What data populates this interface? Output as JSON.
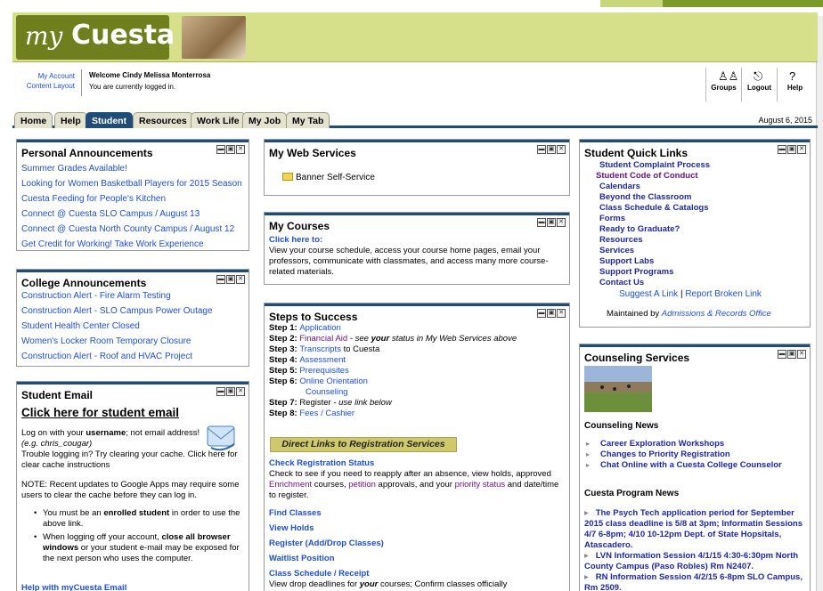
{
  "logo": {
    "my": "my",
    "cuesta": "Cuesta"
  },
  "user": {
    "my_account": "My Account",
    "content_layout": "Content Layout",
    "welcome": "Welcome Cindy Melissa Monterrosa",
    "status": "You are currently logged in."
  },
  "top_icons": [
    {
      "label": "Groups",
      "icon": "groups-icon"
    },
    {
      "label": "Logout",
      "icon": "logout-icon"
    },
    {
      "label": "Help",
      "icon": "help-icon"
    }
  ],
  "tabs": [
    "Home",
    "Help",
    "Student",
    "Resources",
    "Work Life",
    "My Job",
    "My Tab"
  ],
  "date": "August 6, 2015",
  "personal": {
    "title": "Personal Announcements",
    "items": [
      "Summer Grades Available!",
      "Looking for Women Basketball Players for 2015 Season",
      "Cuesta Feeding for People's Kitchen",
      "Connect @ Cuesta SLO Campus / August 13",
      "Connect @ Cuesta North County Campus / August 12",
      "Get Credit for Working! Take Work Experience"
    ]
  },
  "college": {
    "title": "College Announcements",
    "items": [
      "Construction Alert - Fire Alarm Testing",
      "Construction Alert - SLO Campus Power Outage",
      "Student Health Center Closed",
      "Women's Locker Room Temporary Closure",
      "Construction Alert - Roof and HVAC Project"
    ]
  },
  "email": {
    "title": "Student Email",
    "big_link": "Click here for student email",
    "line1a": "Log on with your ",
    "line1b": "username",
    "line1c": "; not email address!",
    "line2": "(e.g. chris_cougar)",
    "line3": "Trouble logging in? Try clearing your cache. Click here for clear cache instructions",
    "note": "NOTE: Recent updates to Google Apps may require some users to clear the cache before they can log in.",
    "bullet1a": "You must be an ",
    "bullet1b": "enrolled student",
    "bullet1c": " in order to use the above link.",
    "bullet2a": "When logging off your account, ",
    "bullet2b": "close all browser windows",
    "bullet2c": " or your student e-mail may be exposed for the next person who uses the computer.",
    "help": "Help with myCuesta Email"
  },
  "webservices": {
    "title": "My Web Services",
    "item": "Banner Self-Service"
  },
  "courses": {
    "title": "My Courses",
    "link": "Click here to:",
    "text": "View your course schedule, access your course home pages, email your professors, communicate with classmates, and access many more course-related materials."
  },
  "steps": {
    "title": "Steps to Success",
    "s1": "Step 1: ",
    "s1l": "Application",
    "s2": "Step 2: ",
    "s2l": "Financial Aid",
    "s2a": " - see ",
    "s2b": "your",
    "s2c": " status in My Web Services above",
    "s3": "Step 3: ",
    "s3l": "Transcripts",
    "s3a": " to Cuesta",
    "s4": "Step 4: ",
    "s4l": "Assessment",
    "s5": "Step 5: ",
    "s5l": "Prerequisites",
    "s6": "Step 6: ",
    "s6l": "Online Orientation",
    "s6l2": "Counseling",
    "s7": "Step 7: ",
    "s7a": "Register - ",
    "s7b": "use link below",
    "s8": "Step 8: ",
    "s8l": "Fees / Cashier",
    "direct": "Direct Links to Registration Services",
    "check": "Check Registration Status",
    "check_t1": "Check to see if you need to reapply after an absence, view holds, approved ",
    "enrich": "Enrichment",
    "check_t2": " courses, ",
    "petition": "petition",
    "check_t3": " approvals, and your ",
    "priority": "priority status",
    "check_t4": " and date/time to register.",
    "find": "Find Classes",
    "holds": "View Holds",
    "register": "Register (Add/Drop Classes)",
    "waitlist": "Waitlist Position",
    "sched": "Class Schedule / Receipt",
    "sched_t1": "View drop deadlines for ",
    "sched_t2": "your",
    "sched_t3": " courses; Confirm classes officially dropped/removed from schedule."
  },
  "quick": {
    "title": "Student Quick Links",
    "items": [
      "Student Complaint Process",
      "Student Code of Conduct",
      "Calendars",
      "Beyond the Classroom",
      "Class Schedule & Catalogs",
      "Forms",
      "Ready to Graduate?",
      "Resources",
      "Services",
      "Support Labs",
      "Support Programs",
      "Contact Us"
    ],
    "suggest": "Suggest A Link",
    "bar": " | ",
    "broken": "Report Broken Link",
    "maint": "Maintained by ",
    "maint_link": "Admissions & Records Office"
  },
  "counseling": {
    "title": "Counseling Services",
    "news_title": "Counseling News",
    "news": [
      "Career Exploration Workshops",
      "Changes to Priority Registration",
      "Chat Online with a Cuesta College Counselor"
    ],
    "program_title": "Cuesta Program News",
    "p1": "The Psych Tech application period for September 2015 class deadline is 5/8 at 3pm; Informatin Sessions 4/7 6-8pm; 4/10 10-12pm Dept. of State Hopsitals, Atascadero.",
    "p2": "LVN Information Session 4/1/15 4:30-6:30pm North County Campus (Paso Robles) Rm N2407.",
    "p3": "RN Information Session 4/2/15 6-8pm SLO Campus, Rm 2509."
  },
  "colors": {
    "header_bg": "#d6e08a",
    "logo_bg": "#6f7f1e",
    "tab_active": "#1f4d78",
    "link": "#1d4fd8",
    "dark_link": "#1d27a8",
    "purple": "#6b1486"
  }
}
